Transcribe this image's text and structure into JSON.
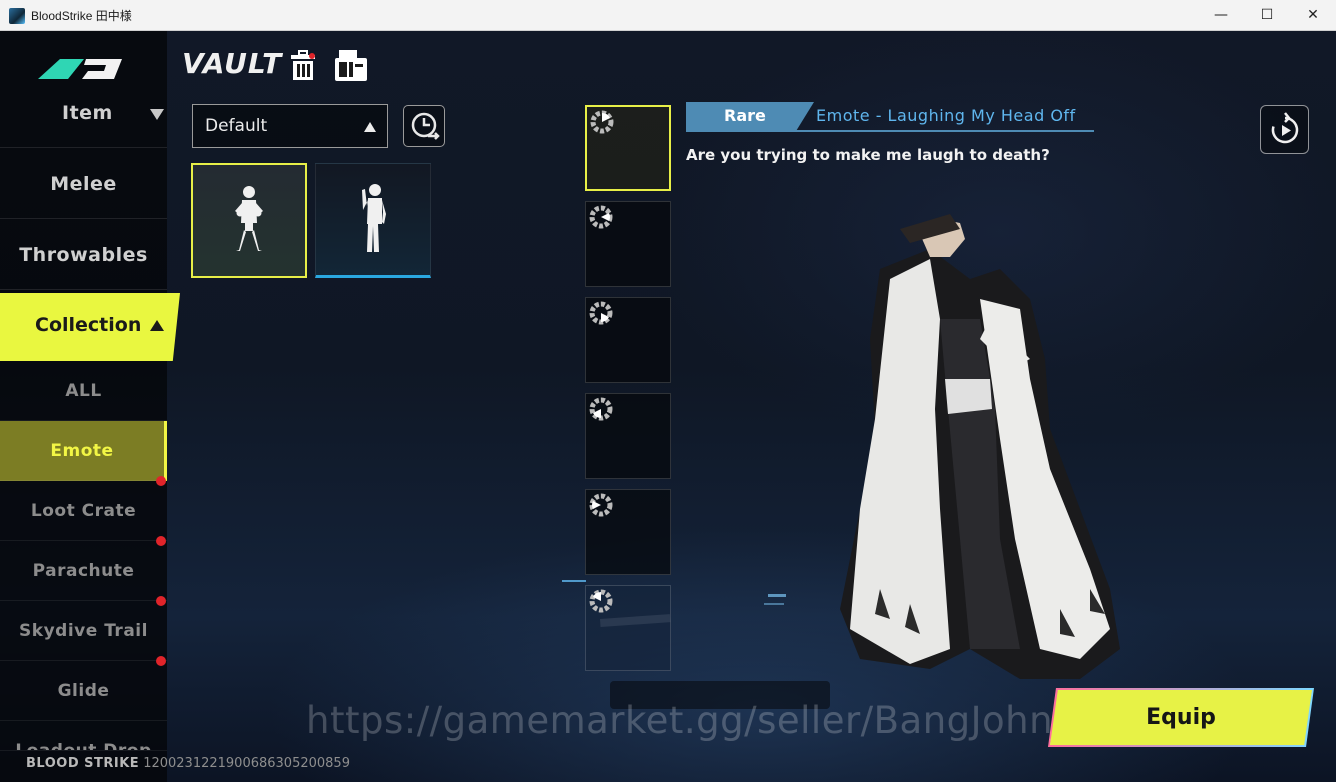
{
  "window": {
    "title": "BloodStrike 田中様",
    "min_glyph": "—",
    "max_glyph": "☐",
    "close_glyph": "✕"
  },
  "sidebar": {
    "category": "Item",
    "items": [
      {
        "label": "Melee"
      },
      {
        "label": "Throwables"
      }
    ],
    "section": "Collection",
    "subitems": [
      {
        "label": "ALL",
        "active": false,
        "badge": false
      },
      {
        "label": "Emote",
        "active": true,
        "badge": false
      },
      {
        "label": "Loot Crate",
        "active": false,
        "badge": true
      },
      {
        "label": "Parachute",
        "active": false,
        "badge": true
      },
      {
        "label": "Skydive Trail",
        "active": false,
        "badge": true
      },
      {
        "label": "Glide",
        "active": false,
        "badge": true
      },
      {
        "label": "Loadout Drop",
        "active": false,
        "badge": false
      }
    ]
  },
  "vault": {
    "title": "VAULT",
    "filter_value": "Default",
    "icons": [
      "trash-icon",
      "locker-icon",
      "history-icon"
    ]
  },
  "emote_cards": [
    {
      "pose": "boxing-pose",
      "selected": true
    },
    {
      "pose": "wave-pose",
      "selected": false
    }
  ],
  "slots": [
    {
      "index": 1,
      "selected": true
    },
    {
      "index": 2,
      "selected": false
    },
    {
      "index": 3,
      "selected": false
    },
    {
      "index": 4,
      "selected": false
    },
    {
      "index": 5,
      "selected": false
    },
    {
      "index": 6,
      "selected": false
    }
  ],
  "detail": {
    "rarity": "Rare",
    "name": "Emote - Laughing My Head Off",
    "description": "Are you trying to make me laugh to death?"
  },
  "equip_label": "Equip",
  "footer": {
    "brand": "BLOOD STRIKE",
    "player_id": "1200231221900686305200859"
  },
  "watermark": "https://gamemarket.gg/seller/BangJohn",
  "colors": {
    "accent_yellow": "#e7f246",
    "rare_blue": "#4e8bb4",
    "name_blue": "#5fb6ee",
    "badge_red": "#e0242a"
  }
}
